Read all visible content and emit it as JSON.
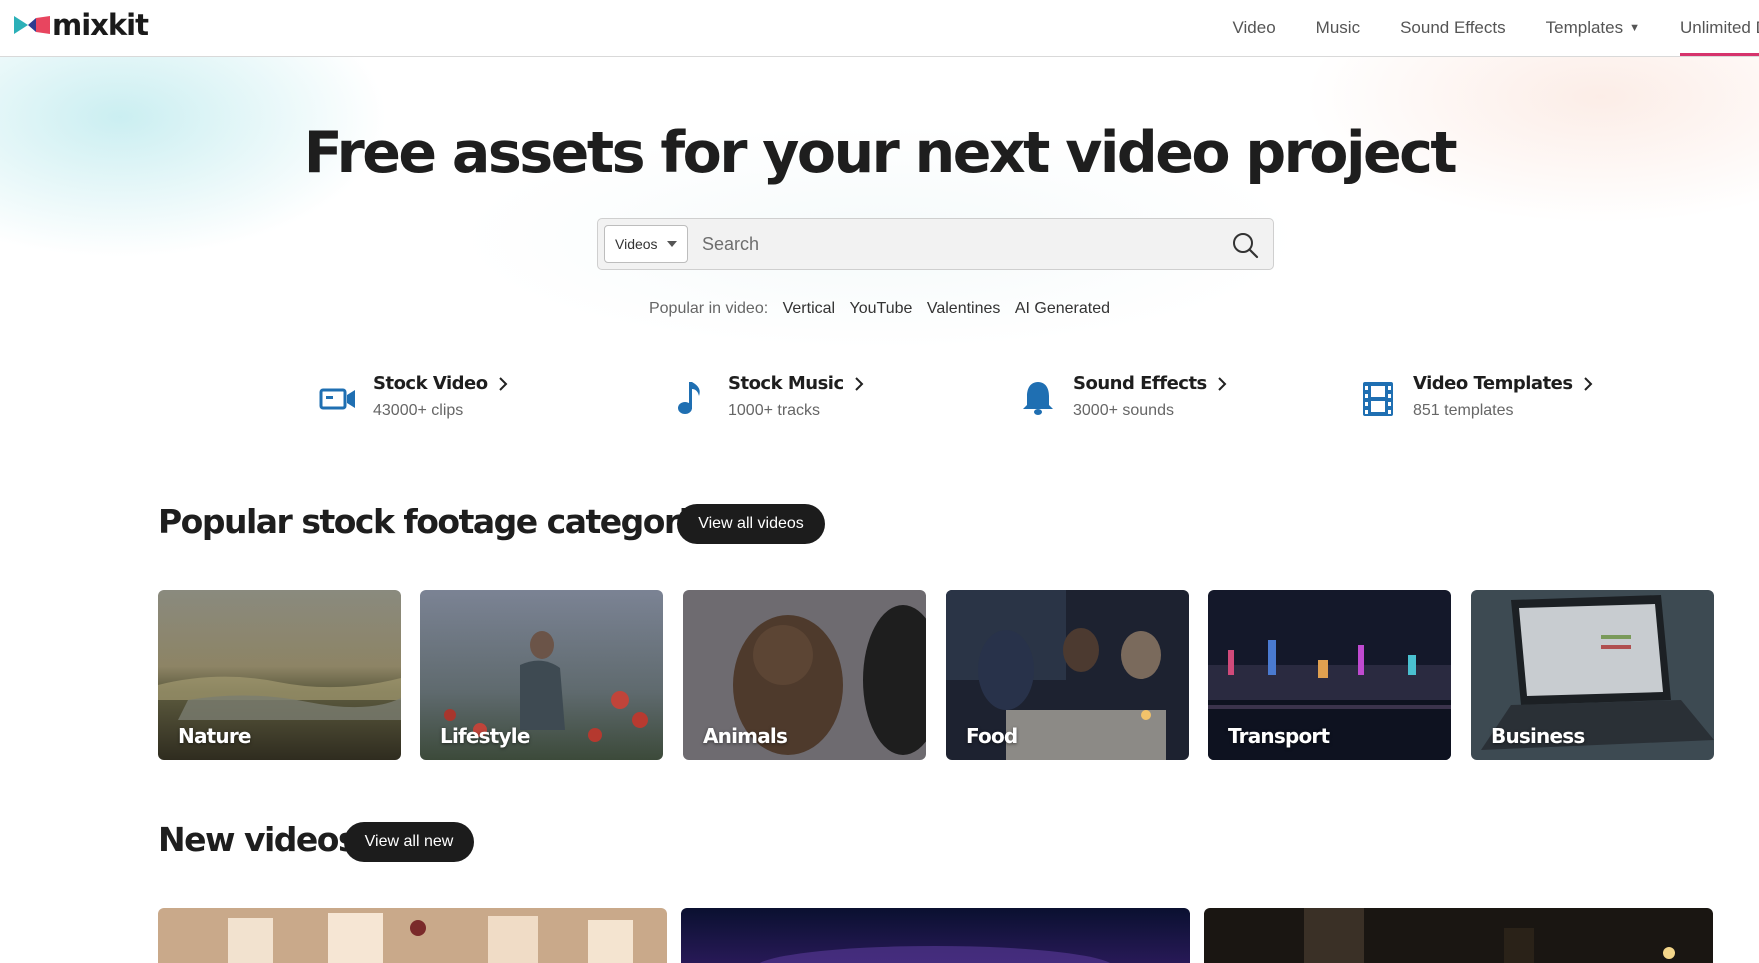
{
  "header": {
    "logo_text": "mixkit",
    "nav": [
      {
        "label": "Video"
      },
      {
        "label": "Music"
      },
      {
        "label": "Sound Effects"
      },
      {
        "label": "Templates"
      },
      {
        "label": "Unlimited D"
      }
    ]
  },
  "hero": {
    "title": "Free assets for your next video project",
    "search": {
      "type_selected": "Videos",
      "placeholder": "Search"
    },
    "popular": {
      "label": "Popular in video:",
      "tags": [
        "Vertical",
        "YouTube",
        "Valentines",
        "AI Generated"
      ]
    }
  },
  "asset_types": [
    {
      "title": "Stock Video",
      "subtitle": "43000+ clips",
      "icon": "video-camera-icon"
    },
    {
      "title": "Stock Music",
      "subtitle": "1000+ tracks",
      "icon": "music-note-icon"
    },
    {
      "title": "Sound Effects",
      "subtitle": "3000+ sounds",
      "icon": "bell-icon"
    },
    {
      "title": "Video Templates",
      "subtitle": "851 templates",
      "icon": "film-strip-icon"
    }
  ],
  "popular_categories": {
    "title": "Popular stock footage categories",
    "view_all_label": "View all videos",
    "items": [
      {
        "label": "Nature"
      },
      {
        "label": "Lifestyle"
      },
      {
        "label": "Animals"
      },
      {
        "label": "Food"
      },
      {
        "label": "Transport"
      },
      {
        "label": "Business"
      }
    ]
  },
  "new_videos": {
    "title": "New videos",
    "view_all_label": "View all new"
  },
  "colors": {
    "accent_pink": "#d6336c",
    "icon_blue": "#1f6fb2",
    "pill_bg": "#1c1c1c"
  }
}
